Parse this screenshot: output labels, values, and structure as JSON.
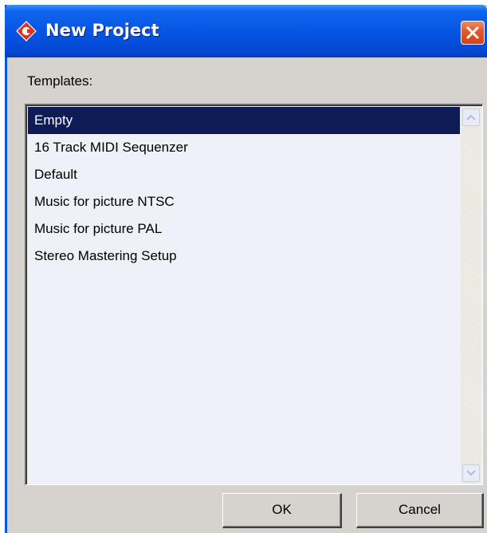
{
  "window": {
    "title": "New Project",
    "icon": "cubase-logo-icon",
    "close_icon": "close-icon"
  },
  "templates": {
    "label": "Templates:",
    "items": [
      "Empty",
      "16 Track MIDI Sequenzer",
      "Default",
      "Music for picture NTSC",
      "Music for picture PAL",
      "Stereo Mastering Setup"
    ],
    "selected": "Empty"
  },
  "buttons": {
    "ok": "OK",
    "cancel": "Cancel"
  },
  "colors": {
    "titlebar": "#0755e4",
    "selection": "#0f1b56",
    "list_background": "#eff0f8",
    "dialog_background": "#d6d3ce",
    "close_button": "#e35a2e"
  }
}
